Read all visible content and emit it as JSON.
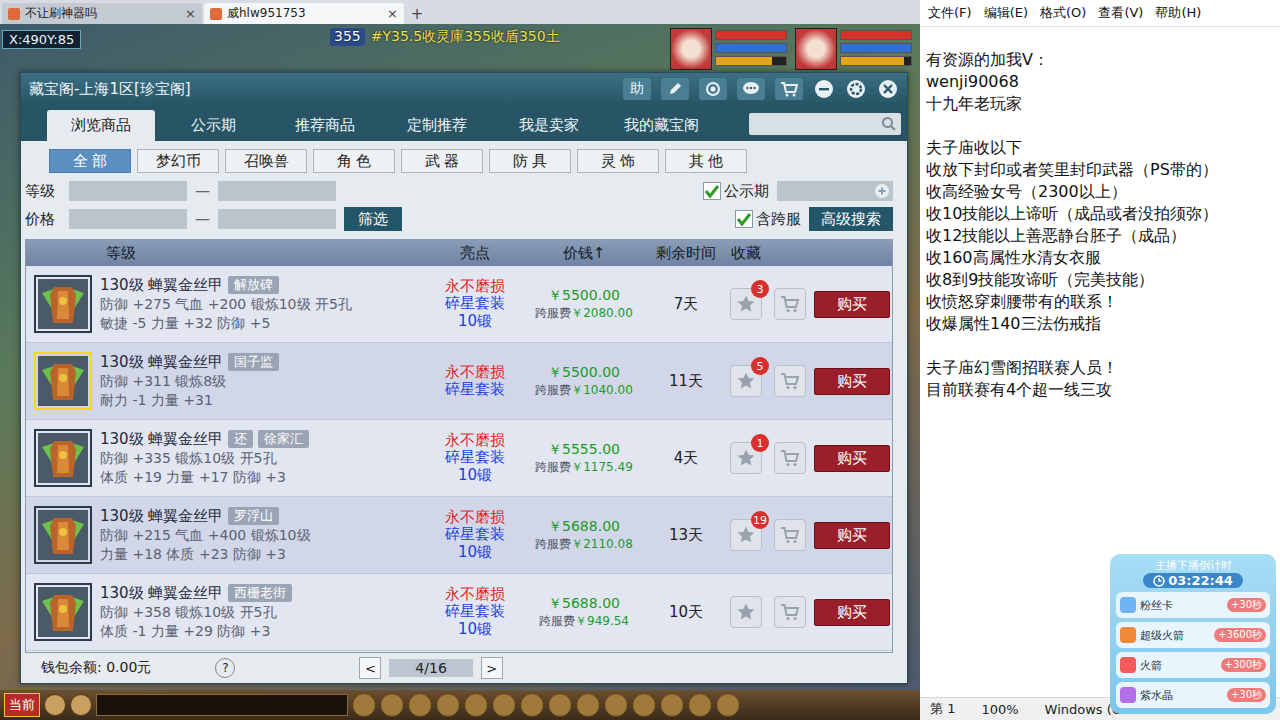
{
  "browserTabs": [
    {
      "label": "不让刷神器吗",
      "selected": false
    },
    {
      "label": "威hlw951753",
      "selected": true
    }
  ],
  "tabClose": "×",
  "newTab": "+",
  "game": {
    "coords": "X:490Y:85",
    "banner": "#Y35.5收灵庫355收盾350土",
    "bannerSub": "355",
    "toolbarButton": "当前",
    "party": [
      {
        "bars": [
          {
            "level": 1,
            "color": "#d8332a"
          },
          {
            "level": 1,
            "color": "#2f6fd6"
          },
          {
            "level": 0.8,
            "color": "#e2a51d"
          }
        ]
      },
      {
        "bars": [
          {
            "level": 1,
            "color": "#d8332a"
          },
          {
            "level": 1,
            "color": "#2f6fd6"
          },
          {
            "level": 0.9,
            "color": "#e2a51d"
          }
        ]
      }
    ]
  },
  "market": {
    "title": "藏宝阁-上海1区[珍宝阁]",
    "helpButton": "助",
    "tabs": [
      {
        "label": "浏览商品",
        "selected": true
      },
      {
        "label": "公示期",
        "selected": false
      },
      {
        "label": "推荐商品",
        "selected": false
      },
      {
        "label": "定制推荐",
        "selected": false
      },
      {
        "label": "我是卖家",
        "selected": false
      },
      {
        "label": "我的藏宝阁",
        "selected": false
      }
    ],
    "categories": [
      {
        "label": "全 部",
        "selected": true
      },
      {
        "label": "梦幻币",
        "selected": false
      },
      {
        "label": "召唤兽",
        "selected": false
      },
      {
        "label": "角 色",
        "selected": false
      },
      {
        "label": "武 器",
        "selected": false
      },
      {
        "label": "防 具",
        "selected": false
      },
      {
        "label": "灵 饰",
        "selected": false
      },
      {
        "label": "其 他",
        "selected": false
      }
    ],
    "filters": {
      "levelLabel": "等级",
      "priceLabel": "价格",
      "dash": "—",
      "filterButton": "筛选",
      "advancedButton": "高级搜索",
      "checkboxes": [
        {
          "label": "公示期",
          "checked": true
        },
        {
          "label": "含跨服",
          "checked": true
        }
      ]
    },
    "columns": [
      "等级",
      "亮点",
      "价钱↑",
      "剩余时间",
      "收藏"
    ],
    "rows": [
      {
        "name": "130级  蝉翼金丝甲",
        "tags": [
          "解放碑"
        ],
        "stats": [
          "防御 +275 气血 +200 锻炼10级 开5孔",
          "敏捷 -5 力量 +32 防御 +5"
        ],
        "highlights": [
          {
            "text": "永不磨损",
            "color": "#e01f1f"
          },
          {
            "text": "碎星套装",
            "color": "#1b3fe0"
          },
          {
            "text": "10锻",
            "color": "#1b3fe0"
          }
        ],
        "price": "￥5500.00",
        "crossFeeLabel": "跨服费",
        "crossFee": "￥2080.00",
        "time": "7天",
        "favorites": "3",
        "buy": "购买",
        "selected": false
      },
      {
        "name": "130级  蝉翼金丝甲",
        "tags": [
          "国子监"
        ],
        "stats": [
          "防御 +311 锻炼8级",
          "耐力 -1 力量 +31"
        ],
        "highlights": [
          {
            "text": "永不磨损",
            "color": "#e01f1f"
          },
          {
            "text": "碎星套装",
            "color": "#1b3fe0"
          }
        ],
        "price": "￥5500.00",
        "crossFeeLabel": "跨服费",
        "crossFee": "￥1040.00",
        "time": "11天",
        "favorites": "5",
        "buy": "购买",
        "selected": true
      },
      {
        "name": "130级  蝉翼金丝甲",
        "tags": [
          "还",
          "徐家汇"
        ],
        "stats": [
          "防御 +335 锻炼10级 开5孔",
          "体质 +19 力量 +17 防御 +3"
        ],
        "highlights": [
          {
            "text": "永不磨损",
            "color": "#e01f1f"
          },
          {
            "text": "碎星套装",
            "color": "#1b3fe0"
          },
          {
            "text": "10锻",
            "color": "#1b3fe0"
          }
        ],
        "price": "￥5555.00",
        "crossFeeLabel": "跨服费",
        "crossFee": "￥1175.49",
        "time": "4天",
        "favorites": "1",
        "buy": "购买",
        "selected": false
      },
      {
        "name": "130级  蝉翼金丝甲",
        "tags": [
          "罗浮山"
        ],
        "stats": [
          "防御 +215 气血 +400 锻炼10级",
          "力量 +18 体质 +23 防御 +3"
        ],
        "highlights": [
          {
            "text": "永不磨损",
            "color": "#e01f1f"
          },
          {
            "text": "碎星套装",
            "color": "#1b3fe0"
          },
          {
            "text": "10锻",
            "color": "#1b3fe0"
          }
        ],
        "price": "￥5688.00",
        "crossFeeLabel": "跨服费",
        "crossFee": "￥2110.08",
        "time": "13天",
        "favorites": "19",
        "buy": "购买",
        "selected": false
      },
      {
        "name": "130级  蝉翼金丝甲",
        "tags": [
          "西栅老街"
        ],
        "stats": [
          "防御 +358 锻炼10级 开5孔",
          "体质 -1 力量 +29 防御 +3"
        ],
        "highlights": [
          {
            "text": "永不磨损",
            "color": "#e01f1f"
          },
          {
            "text": "碎星套装",
            "color": "#1b3fe0"
          },
          {
            "text": "10锻",
            "color": "#1b3fe0"
          }
        ],
        "price": "￥5688.00",
        "crossFeeLabel": "跨服费",
        "crossFee": "￥949.54",
        "time": "10天",
        "favorites": "",
        "buy": "购买",
        "selected": false
      }
    ],
    "footer": {
      "wallet": "钱包余额: 0.00元",
      "help": "?",
      "prev": "<",
      "page": "4/16",
      "next": ">"
    }
  },
  "notepad": {
    "menu": [
      "文件(F)",
      "编辑(E)",
      "格式(O)",
      "查看(V)",
      "帮助(H)"
    ],
    "lines": [
      "有资源的加我V：",
      "wenji90068",
      "十九年老玩家",
      "",
      "夫子庙收以下",
      "收放下封印或者笑里封印武器（PS带的）",
      "收高经验女号（2300以上）",
      "收10技能以上谛听（成品或者没拍须弥）",
      "收12技能以上善恶静台胚子（成品）",
      "收160高属性水清女衣服",
      "收8到9技能攻谛听（完美技能）",
      "收愤怒穿刺腰带有的联系！",
      "收爆属性140三法伤戒指",
      "",
      "夫子庙幻雪阁招联赛人员！",
      "目前联赛有4个超一线三攻"
    ],
    "status": [
      "第 1",
      "100%",
      "Windows (C"
    ]
  },
  "stream": {
    "title": "主播下播倒计时",
    "time": "03:22:44",
    "items": [
      {
        "label": "粉丝卡",
        "bonus": "+30秒",
        "color": "#6fb3f0"
      },
      {
        "label": "超级火箭",
        "bonus": "+3600秒",
        "color": "#f08a3a"
      },
      {
        "label": "火箭",
        "bonus": "+300秒",
        "color": "#f05a5a"
      },
      {
        "label": "紫水晶",
        "bonus": "+30秒",
        "color": "#b070e8"
      }
    ]
  }
}
